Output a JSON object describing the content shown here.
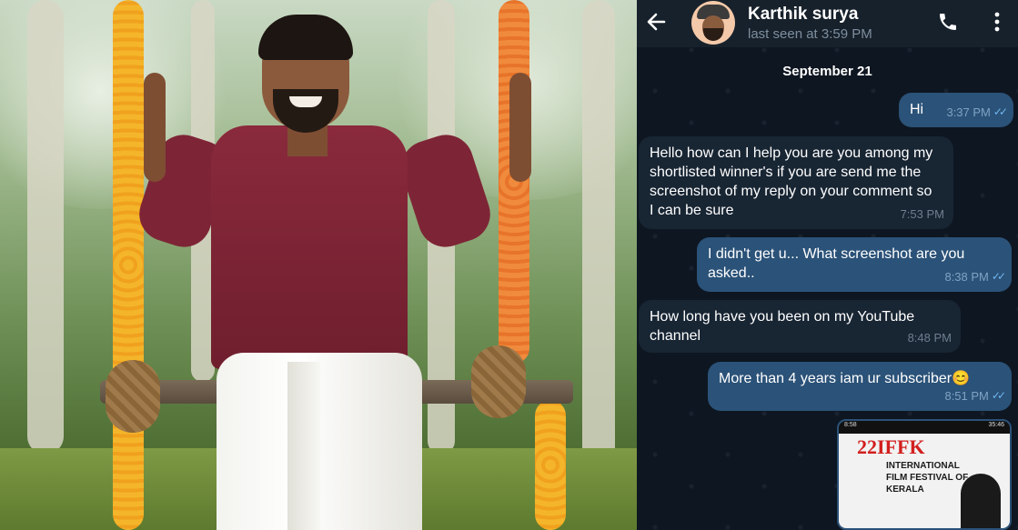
{
  "chat": {
    "contact_name": "Karthik surya",
    "last_seen": "last seen at 3:59 PM",
    "date_divider": "September 21",
    "icons": {
      "back": "back-arrow-icon",
      "call": "phone-icon",
      "menu": "more-vertical-icon"
    },
    "messages": [
      {
        "dir": "out",
        "text": "Hi",
        "time": "3:37 PM"
      },
      {
        "dir": "in",
        "text": "Hello how can I help you are you among my shortlisted winner's if you are send me the screenshot of my reply on your comment so I can be sure",
        "time": "7:53 PM"
      },
      {
        "dir": "out",
        "text": "I didn't get u... What screenshot are you asked..",
        "time": "8:38 PM"
      },
      {
        "dir": "in",
        "text": "How long have you been on my YouTube channel",
        "time": "8:48 PM"
      },
      {
        "dir": "out",
        "text": "More than 4 years iam ur subscriber😊",
        "time": "8:51 PM"
      }
    ],
    "attachment": {
      "status_left": "8:58",
      "status_right": "35:46",
      "poster_number": "22",
      "poster_brand": "IFFK",
      "poster_line1": "INTERNATIONAL",
      "poster_line2": "FILM FESTIVAL OF",
      "poster_line3": "KERALA"
    },
    "colors": {
      "outgoing": "#2b5278",
      "incoming": "#182533",
      "background": "#0e1621",
      "header": "#17212b"
    }
  }
}
